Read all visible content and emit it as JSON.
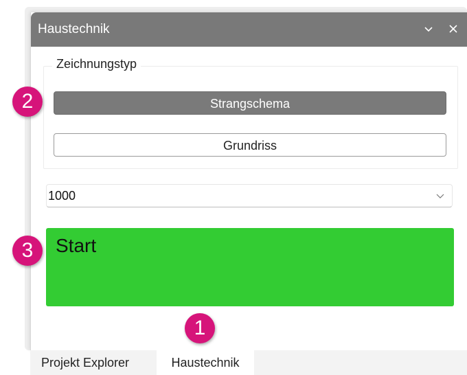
{
  "panel": {
    "title": "Haustechnik",
    "title_icons": [
      "chevron-down-icon",
      "close-icon"
    ]
  },
  "drawing_type": {
    "legend": "Zeichnungstyp",
    "options": [
      {
        "label": "Strangschema",
        "selected": true
      },
      {
        "label": "Grundriss",
        "selected": false
      }
    ]
  },
  "scale_select": {
    "value": "1000",
    "icon": "chevron-down-icon"
  },
  "start_button": {
    "label": "Start",
    "color": "#33cc33"
  },
  "tabs": [
    {
      "label": "Projekt Explorer",
      "active": false
    },
    {
      "label": "Haustechnik",
      "active": true
    }
  ],
  "markers": [
    "1",
    "2",
    "3"
  ],
  "colors": {
    "titlebar": "#797979",
    "selected_button": "#7a7a7a",
    "marker": "#d6147a"
  }
}
